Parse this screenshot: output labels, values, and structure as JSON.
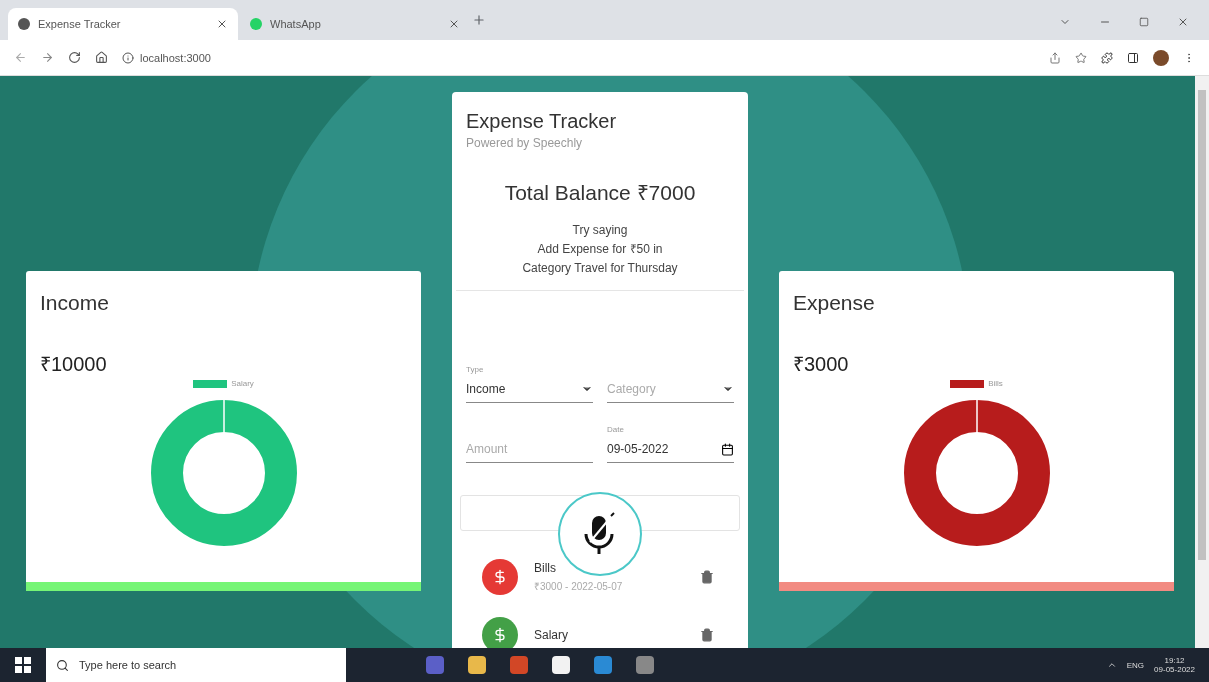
{
  "browser": {
    "tabs": [
      {
        "title": "Expense Tracker",
        "selected": true
      },
      {
        "title": "WhatsApp",
        "selected": false
      }
    ],
    "address": "localhost:3000"
  },
  "income": {
    "title": "Income",
    "amount": "₹10000",
    "legend": "Salary",
    "color": "#1fc47f",
    "bar": {
      "color": "#76f576"
    }
  },
  "tracker": {
    "title": "Expense Tracker",
    "subtitle": "Powered by Speechly",
    "balance": "Total Balance ₹7000",
    "hint": [
      "Try saying",
      "Add Expense for ₹50 in",
      "Category Travel for Thursday"
    ],
    "form": {
      "type": {
        "label": "Type",
        "value": "Income"
      },
      "category": {
        "placeholder": "Category"
      },
      "amount": {
        "placeholder": "Amount"
      },
      "date": {
        "label": "Date",
        "value": "09-05-2022"
      }
    },
    "transactions": [
      {
        "name": "Bills",
        "detail": "₹3000 - 2022-05-07",
        "color": "#e53935"
      },
      {
        "name": "Salary",
        "color": "#43a047"
      }
    ]
  },
  "expense": {
    "title": "Expense",
    "amount": "₹3000",
    "legend": "Bills",
    "color": "#b71c1c",
    "bar": {
      "color": "#f28b82"
    }
  },
  "taskbar": {
    "search_placeholder": "Type here to search",
    "language": "ENG",
    "time": "19:12",
    "date": "09-05-2022"
  }
}
